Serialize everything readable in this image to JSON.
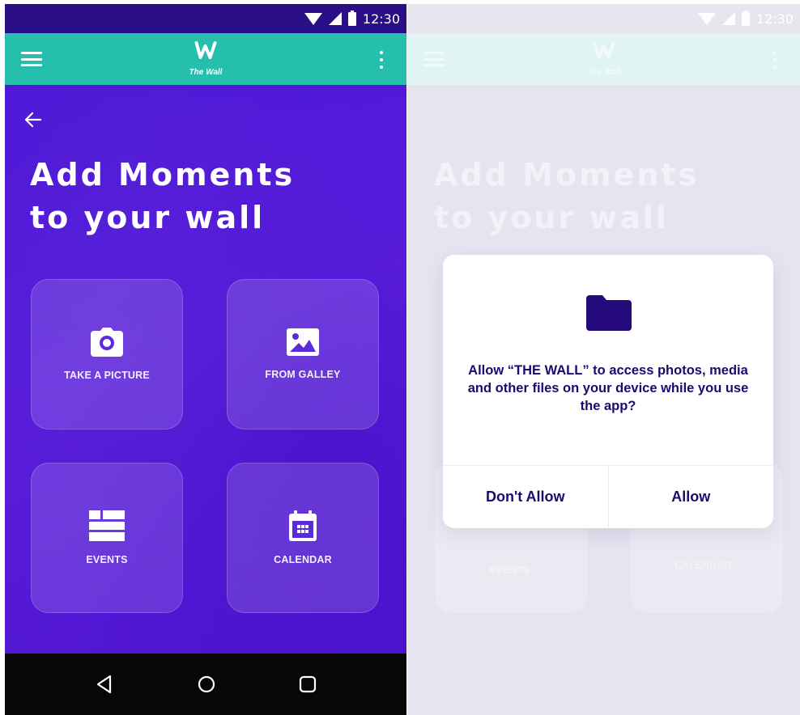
{
  "status_bar": {
    "time": "12:30"
  },
  "app_bar": {
    "logo_text": "The Wall"
  },
  "screen": {
    "title_line1": "Add Moments",
    "title_line2": "to your wall",
    "tiles": [
      {
        "label": "TAKE A PICTURE",
        "icon": "camera-icon"
      },
      {
        "label": "FROM GALLEY",
        "icon": "image-icon"
      },
      {
        "label": "EVENTS",
        "icon": "events-icon"
      },
      {
        "label": "CALENDAR",
        "icon": "calendar-icon"
      }
    ]
  },
  "dialog": {
    "icon": "folder-icon",
    "message": "Allow “THE WALL” to access photos, media and other files on your device while you use the app?",
    "deny_label": "Don't Allow",
    "allow_label": "Allow"
  },
  "colors": {
    "status_bar": "#2a0e86",
    "app_bar": "#26bfad",
    "background_purple": "#4f17d6",
    "dialog_text": "#1d0a6e",
    "navbar": "#070707"
  }
}
